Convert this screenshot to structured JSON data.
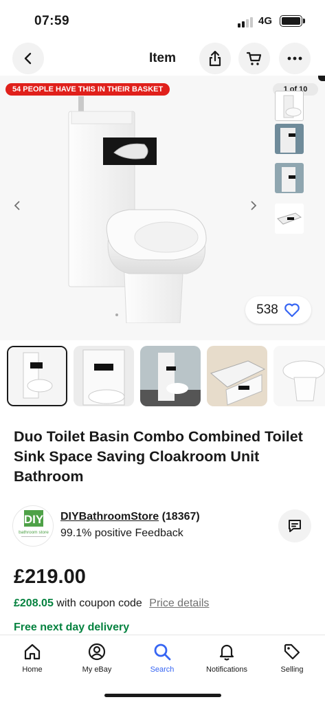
{
  "status_bar": {
    "time": "07:59",
    "network": "4G"
  },
  "nav": {
    "title": "Item",
    "icons": [
      "back-arrow-icon",
      "share-icon",
      "cart-icon",
      "more-icon"
    ]
  },
  "gallery": {
    "basket_banner": "54 PEOPLE HAVE THIS IN THEIR BASKET",
    "counter": "1 of 10",
    "likes": "538",
    "banner_color": "#e0201b"
  },
  "item": {
    "title": "Duo Toilet Basin Combo Combined Toilet Sink Space Saving Cloakroom Unit Bathroom"
  },
  "seller": {
    "logo_text": "DIY",
    "logo_subtext": "bathroom store",
    "name": "DIYBathroomStore",
    "rating_count": "(18367)",
    "feedback": "99.1% positive Feedback"
  },
  "pricing": {
    "price": "£219.00",
    "coupon_price": "£208.05",
    "coupon_text": "with coupon code",
    "price_details": "Price details",
    "delivery": "Free next day delivery",
    "accent_green": "#05823f"
  },
  "tab_bar": {
    "tabs": [
      {
        "label": "Home",
        "icon": "home-icon"
      },
      {
        "label": "My eBay",
        "icon": "user-icon"
      },
      {
        "label": "Search",
        "icon": "search-icon",
        "active": true
      },
      {
        "label": "Notifications",
        "icon": "bell-icon"
      },
      {
        "label": "Selling",
        "icon": "tag-icon"
      }
    ],
    "active_color": "#3665f3"
  }
}
